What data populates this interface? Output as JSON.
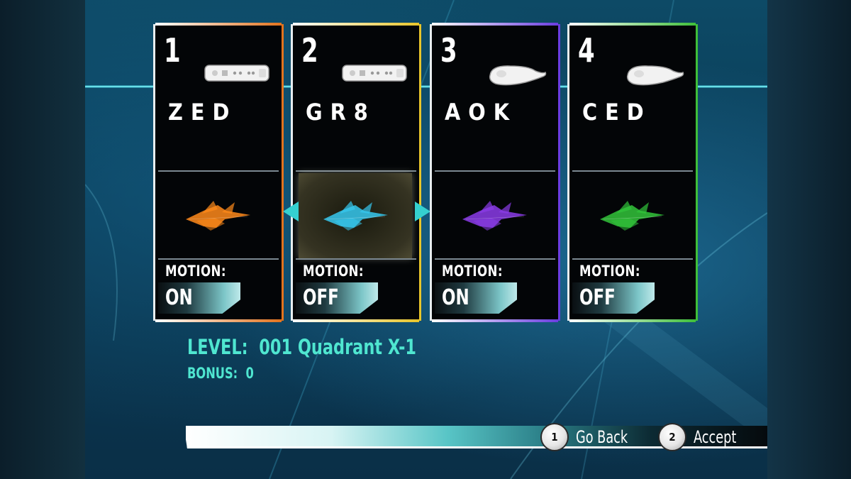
{
  "players": [
    {
      "number": "1",
      "name": "ZED",
      "controller": "wii-remote-icon",
      "motion_label": "MOTION:",
      "motion_value": "ON",
      "color": "#e2731e",
      "ship_color": "#ff8a1a",
      "selected": false
    },
    {
      "number": "2",
      "name": "GR8",
      "controller": "wii-remote-icon",
      "motion_label": "MOTION:",
      "motion_value": "OFF",
      "color": "#e8c52a",
      "ship_color": "#36c8ef",
      "selected": true
    },
    {
      "number": "3",
      "name": "AOK",
      "controller": "nunchuk-icon",
      "motion_label": "MOTION:",
      "motion_value": "ON",
      "color": "#6a3de0",
      "ship_color": "#8b3ce8",
      "selected": false
    },
    {
      "number": "4",
      "name": "CED",
      "controller": "nunchuk-icon",
      "motion_label": "MOTION:",
      "motion_value": "OFF",
      "color": "#3fbf3a",
      "ship_color": "#32c43a",
      "selected": false
    }
  ],
  "level": {
    "label": "LEVEL:",
    "value": "001 Quadrant X-1"
  },
  "bonus": {
    "label": "BONUS:",
    "value": "0"
  },
  "buttons": {
    "back": {
      "key": "1",
      "label": "Go Back"
    },
    "accept": {
      "key": "2",
      "label": "Accept"
    }
  },
  "accent_color": "#4fe6d0"
}
